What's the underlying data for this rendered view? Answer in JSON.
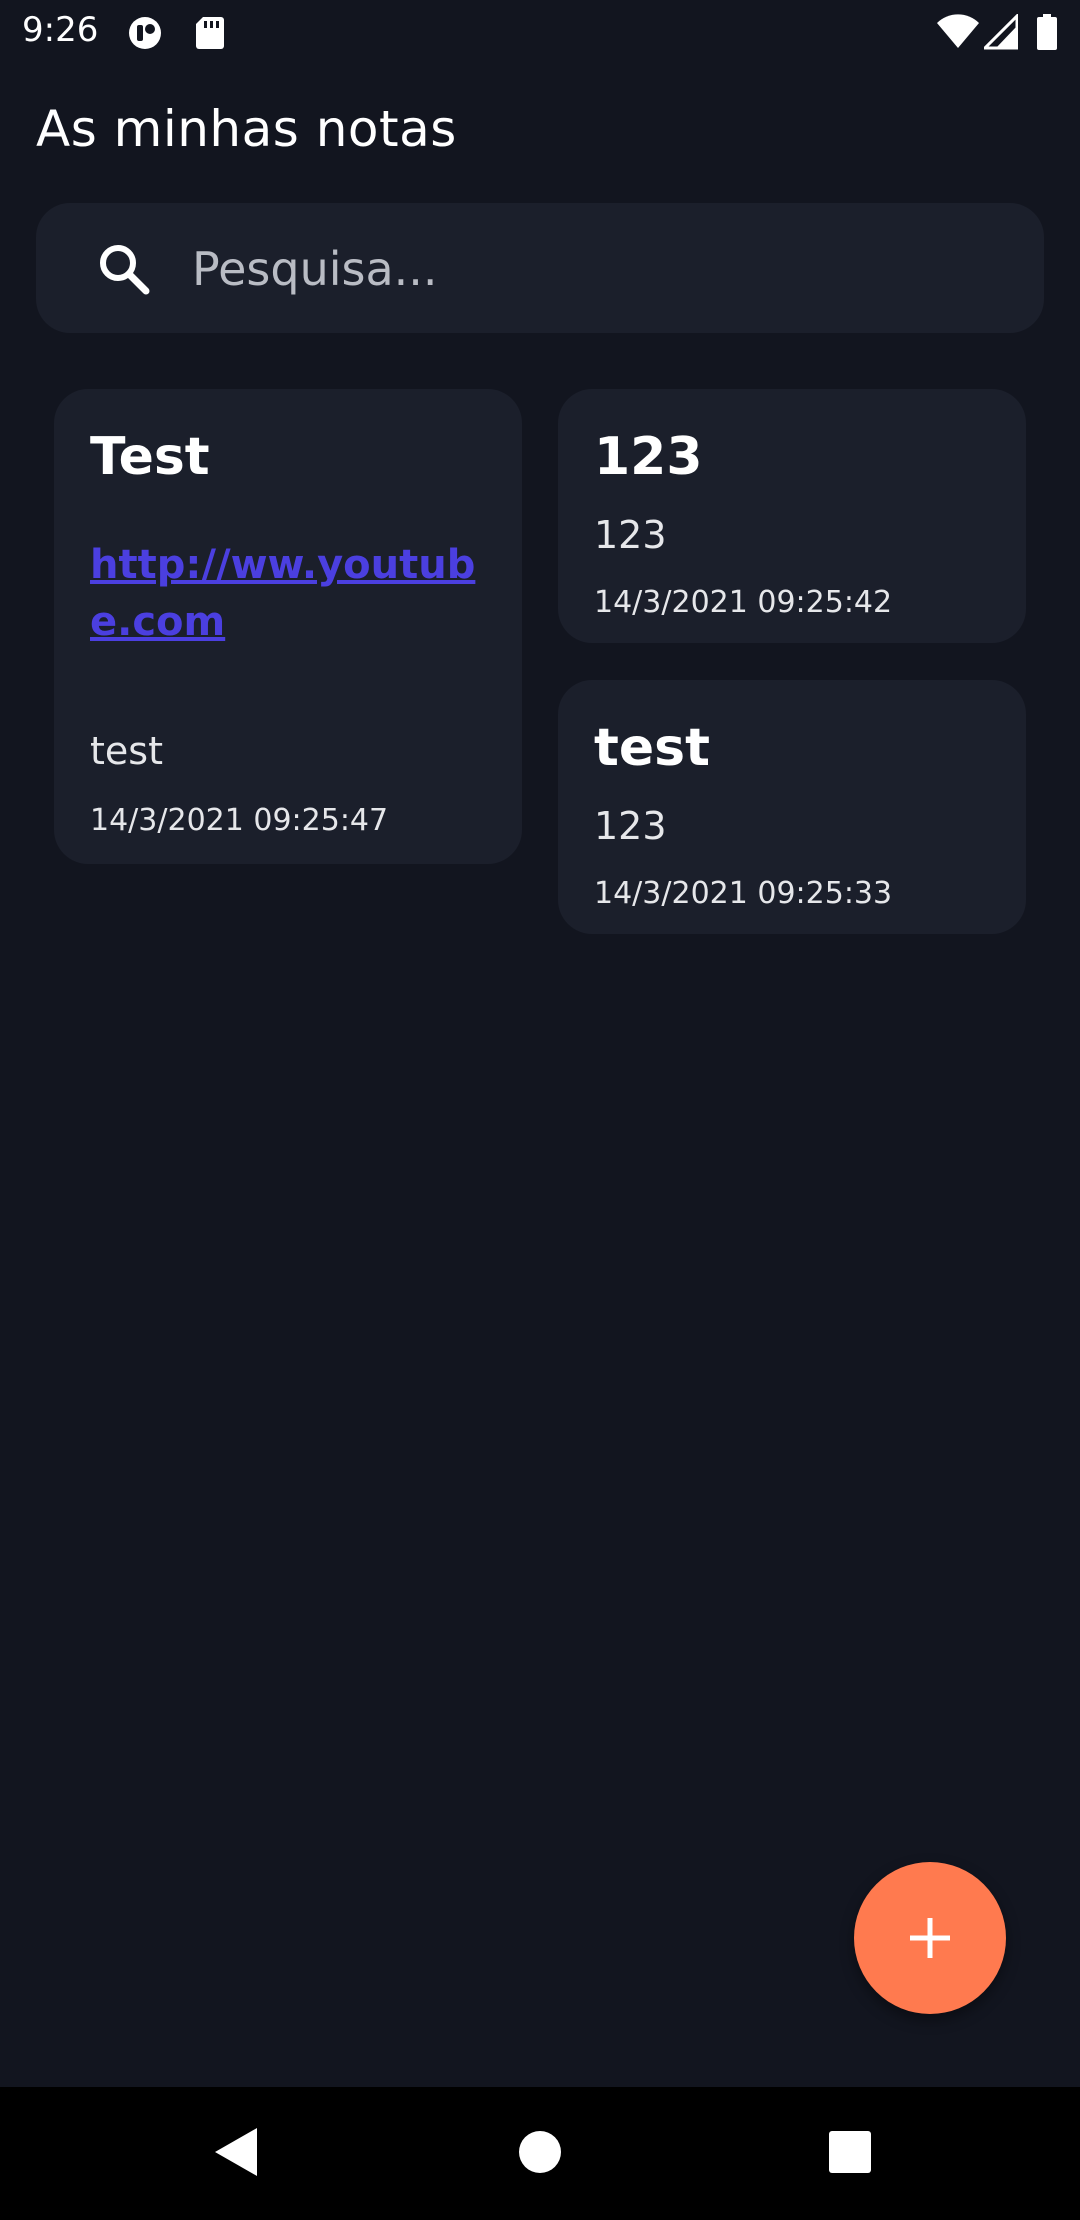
{
  "status_bar": {
    "time": "9:26",
    "left_icons": [
      "notification-icon",
      "sd-card-icon"
    ],
    "right_icons": [
      "wifi-icon",
      "signal-icon",
      "battery-icon"
    ]
  },
  "header": {
    "title": "As minhas notas"
  },
  "search": {
    "placeholder": "Pesquisa..."
  },
  "notes": [
    {
      "title": "Test",
      "link": "http://ww.youtube.com",
      "body": "test",
      "date": "14/3/2021 09:25:47"
    },
    {
      "title": "123",
      "body": "123",
      "date": "14/3/2021 09:25:42"
    },
    {
      "title": "test",
      "body": "123",
      "date": "14/3/2021 09:25:33"
    }
  ],
  "fab": {
    "icon": "plus-icon"
  },
  "nav_bar": {
    "icons": [
      "back-icon",
      "home-icon",
      "recents-icon"
    ]
  },
  "colors": {
    "background": "#12151f",
    "card": "#1b1f2b",
    "accent": "#ff7a4f",
    "link": "#4b3fe0"
  }
}
